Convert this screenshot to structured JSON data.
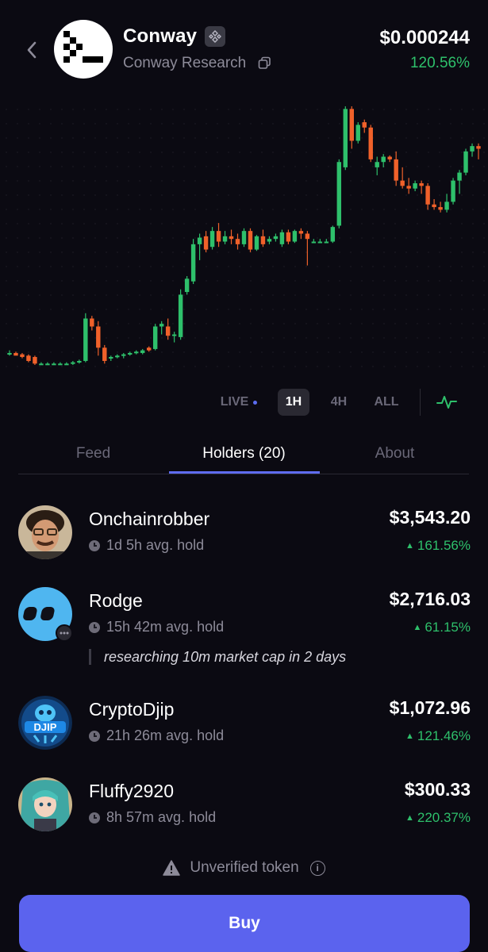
{
  "header": {
    "token_name": "Conway",
    "token_subtitle": "Conway Research",
    "price": "$0.000244",
    "change": "120.56%",
    "icons": {
      "back": "chevron-left-icon",
      "chain": "bnb-chain-icon",
      "copy": "copy-icon"
    }
  },
  "chart_data": {
    "type": "candlestick",
    "title": "",
    "xlabel": "",
    "ylabel": "",
    "colors": {
      "up": "#2ec06b",
      "down": "#f0612a"
    },
    "grid": true,
    "candles": [
      {
        "o": 1.0,
        "h": 1.02,
        "l": 0.98,
        "c": 1.0
      },
      {
        "o": 1.0,
        "h": 1.01,
        "l": 0.99,
        "c": 0.98
      },
      {
        "o": 0.99,
        "h": 1.0,
        "l": 0.96,
        "c": 0.97
      },
      {
        "o": 0.98,
        "h": 0.99,
        "l": 0.93,
        "c": 0.94
      },
      {
        "o": 0.97,
        "h": 0.98,
        "l": 0.91,
        "c": 0.92
      },
      {
        "o": 0.92,
        "h": 0.93,
        "l": 0.91,
        "c": 0.92
      },
      {
        "o": 0.92,
        "h": 0.93,
        "l": 0.91,
        "c": 0.92
      },
      {
        "o": 0.92,
        "h": 0.93,
        "l": 0.91,
        "c": 0.92
      },
      {
        "o": 0.92,
        "h": 0.93,
        "l": 0.91,
        "c": 0.92
      },
      {
        "o": 0.92,
        "h": 0.93,
        "l": 0.91,
        "c": 0.92
      },
      {
        "o": 0.92,
        "h": 0.94,
        "l": 0.91,
        "c": 0.93
      },
      {
        "o": 0.93,
        "h": 0.95,
        "l": 0.92,
        "c": 0.94
      },
      {
        "o": 0.94,
        "h": 1.3,
        "l": 0.93,
        "c": 1.26
      },
      {
        "o": 1.26,
        "h": 1.28,
        "l": 1.17,
        "c": 1.2
      },
      {
        "o": 1.2,
        "h": 1.24,
        "l": 0.98,
        "c": 1.04
      },
      {
        "o": 1.04,
        "h": 1.06,
        "l": 0.92,
        "c": 0.94
      },
      {
        "o": 0.96,
        "h": 0.98,
        "l": 0.94,
        "c": 0.97
      },
      {
        "o": 0.97,
        "h": 0.99,
        "l": 0.96,
        "c": 0.98
      },
      {
        "o": 0.98,
        "h": 1.0,
        "l": 0.96,
        "c": 0.99
      },
      {
        "o": 0.99,
        "h": 1.01,
        "l": 0.98,
        "c": 1.0
      },
      {
        "o": 1.0,
        "h": 1.02,
        "l": 0.99,
        "c": 1.01
      },
      {
        "o": 1.0,
        "h": 1.03,
        "l": 0.99,
        "c": 1.02
      },
      {
        "o": 1.04,
        "h": 1.05,
        "l": 1.01,
        "c": 1.02
      },
      {
        "o": 1.03,
        "h": 1.22,
        "l": 1.02,
        "c": 1.2
      },
      {
        "o": 1.2,
        "h": 1.24,
        "l": 1.14,
        "c": 1.22
      },
      {
        "o": 1.2,
        "h": 1.26,
        "l": 1.1,
        "c": 1.13
      },
      {
        "o": 1.13,
        "h": 1.16,
        "l": 1.08,
        "c": 1.14
      },
      {
        "o": 1.12,
        "h": 1.48,
        "l": 1.1,
        "c": 1.44
      },
      {
        "o": 1.46,
        "h": 1.58,
        "l": 1.44,
        "c": 1.56
      },
      {
        "o": 1.54,
        "h": 1.86,
        "l": 1.52,
        "c": 1.82
      },
      {
        "o": 1.82,
        "h": 1.9,
        "l": 1.7,
        "c": 1.87
      },
      {
        "o": 1.88,
        "h": 1.92,
        "l": 1.76,
        "c": 1.78
      },
      {
        "o": 1.8,
        "h": 1.95,
        "l": 1.78,
        "c": 1.92
      },
      {
        "o": 1.92,
        "h": 1.98,
        "l": 1.8,
        "c": 1.84
      },
      {
        "o": 1.84,
        "h": 1.92,
        "l": 1.82,
        "c": 1.88
      },
      {
        "o": 1.88,
        "h": 1.93,
        "l": 1.82,
        "c": 1.86
      },
      {
        "o": 1.86,
        "h": 1.9,
        "l": 1.78,
        "c": 1.82
      },
      {
        "o": 1.82,
        "h": 1.94,
        "l": 1.8,
        "c": 1.92
      },
      {
        "o": 1.92,
        "h": 1.94,
        "l": 1.76,
        "c": 1.78
      },
      {
        "o": 1.78,
        "h": 1.89,
        "l": 1.77,
        "c": 1.88
      },
      {
        "o": 1.88,
        "h": 1.93,
        "l": 1.8,
        "c": 1.82
      },
      {
        "o": 1.84,
        "h": 1.88,
        "l": 1.82,
        "c": 1.86
      },
      {
        "o": 1.86,
        "h": 1.9,
        "l": 1.84,
        "c": 1.88
      },
      {
        "o": 1.82,
        "h": 1.93,
        "l": 1.8,
        "c": 1.91
      },
      {
        "o": 1.91,
        "h": 1.93,
        "l": 1.82,
        "c": 1.84
      },
      {
        "o": 1.84,
        "h": 1.93,
        "l": 1.83,
        "c": 1.92
      },
      {
        "o": 1.92,
        "h": 1.94,
        "l": 1.86,
        "c": 1.9
      },
      {
        "o": 1.9,
        "h": 1.92,
        "l": 1.66,
        "c": 1.86
      },
      {
        "o": 1.84,
        "h": 1.86,
        "l": 1.83,
        "c": 1.84
      },
      {
        "o": 1.84,
        "h": 1.86,
        "l": 1.83,
        "c": 1.84
      },
      {
        "o": 1.84,
        "h": 1.86,
        "l": 1.83,
        "c": 1.84
      },
      {
        "o": 1.84,
        "h": 1.96,
        "l": 1.83,
        "c": 1.95
      },
      {
        "o": 1.96,
        "h": 2.46,
        "l": 1.94,
        "c": 2.44
      },
      {
        "o": 2.4,
        "h": 2.86,
        "l": 2.38,
        "c": 2.84
      },
      {
        "o": 2.84,
        "h": 2.86,
        "l": 2.54,
        "c": 2.6
      },
      {
        "o": 2.6,
        "h": 2.74,
        "l": 2.58,
        "c": 2.72
      },
      {
        "o": 2.74,
        "h": 2.76,
        "l": 2.66,
        "c": 2.7
      },
      {
        "o": 2.7,
        "h": 2.72,
        "l": 2.44,
        "c": 2.46
      },
      {
        "o": 2.4,
        "h": 2.48,
        "l": 2.34,
        "c": 2.44
      },
      {
        "o": 2.44,
        "h": 2.5,
        "l": 2.4,
        "c": 2.48
      },
      {
        "o": 2.48,
        "h": 2.49,
        "l": 2.44,
        "c": 2.46
      },
      {
        "o": 2.46,
        "h": 2.52,
        "l": 2.26,
        "c": 2.3
      },
      {
        "o": 2.3,
        "h": 2.4,
        "l": 2.24,
        "c": 2.26
      },
      {
        "o": 2.26,
        "h": 2.32,
        "l": 2.2,
        "c": 2.24
      },
      {
        "o": 2.24,
        "h": 2.3,
        "l": 2.22,
        "c": 2.28
      },
      {
        "o": 2.28,
        "h": 2.3,
        "l": 2.2,
        "c": 2.26
      },
      {
        "o": 2.26,
        "h": 2.28,
        "l": 2.08,
        "c": 2.12
      },
      {
        "o": 2.12,
        "h": 2.16,
        "l": 2.08,
        "c": 2.1
      },
      {
        "o": 2.1,
        "h": 2.14,
        "l": 2.06,
        "c": 2.08
      },
      {
        "o": 2.08,
        "h": 2.2,
        "l": 2.06,
        "c": 2.14
      },
      {
        "o": 2.14,
        "h": 2.32,
        "l": 2.12,
        "c": 2.3
      },
      {
        "o": 2.3,
        "h": 2.38,
        "l": 2.2,
        "c": 2.36
      },
      {
        "o": 2.36,
        "h": 2.54,
        "l": 2.34,
        "c": 2.52
      },
      {
        "o": 2.52,
        "h": 2.58,
        "l": 2.48,
        "c": 2.56
      },
      {
        "o": 2.56,
        "h": 2.58,
        "l": 2.46,
        "c": 2.54
      }
    ]
  },
  "range_selector": {
    "options": [
      {
        "label": "LIVE",
        "active": false
      },
      {
        "label": "1H",
        "active": true
      },
      {
        "label": "4H",
        "active": false
      },
      {
        "label": "ALL",
        "active": false
      }
    ],
    "chart_type_icon": "line-pulse-icon"
  },
  "tabs": [
    {
      "label": "Feed",
      "active": false
    },
    {
      "label": "Holders (20)",
      "active": true
    },
    {
      "label": "About",
      "active": false
    }
  ],
  "holders": [
    {
      "name": "Onchainrobber",
      "hold": "1d 5h avg. hold",
      "value": "$3,543.20",
      "change": "161.56%",
      "note": "",
      "avatar": "portrait-avatar"
    },
    {
      "name": "Rodge",
      "hold": "15h 42m avg. hold",
      "value": "$2,716.03",
      "change": "61.15%",
      "note": "researching 10m market cap in 2 days",
      "avatar": "blue-eyes-avatar"
    },
    {
      "name": "CryptoDjip",
      "hold": "21h 26m avg. hold",
      "value": "$1,072.96",
      "change": "121.46%",
      "note": "",
      "avatar": "djip-logo-avatar"
    },
    {
      "name": "Fluffy2920",
      "hold": "8h 57m avg. hold",
      "value": "$300.33",
      "change": "220.37%",
      "note": "",
      "avatar": "anime-avatar"
    }
  ],
  "footer": {
    "unverified_label": "Unverified token",
    "buy_label": "Buy"
  }
}
